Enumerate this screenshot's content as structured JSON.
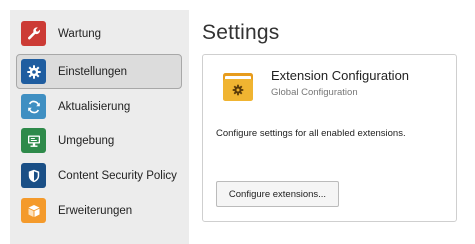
{
  "sidebar": {
    "items": [
      {
        "label": "Wartung",
        "icon": "wrench-icon",
        "color": "#cc3b35",
        "active": false
      },
      {
        "label": "Einstellungen",
        "icon": "gear-icon",
        "color": "#1f5da0",
        "active": true
      },
      {
        "label": "Aktualisierung",
        "icon": "refresh-icon",
        "color": "#3f8fc2",
        "active": false
      },
      {
        "label": "Umgebung",
        "icon": "monitor-icon",
        "color": "#2e8a4a",
        "active": false
      },
      {
        "label": "Content Security Policy",
        "icon": "shield-icon",
        "color": "#1a4f86",
        "active": false
      },
      {
        "label": "Erweiterungen",
        "icon": "box-icon",
        "color": "#f49a2b",
        "active": false
      }
    ]
  },
  "main": {
    "title": "Settings",
    "card": {
      "title": "Extension Configuration",
      "subtitle": "Global Configuration",
      "description": "Configure settings for all enabled extensions.",
      "button_label": "Configure extensions...",
      "icon": "folder-gear-icon",
      "icon_color": "#f0b431"
    }
  }
}
